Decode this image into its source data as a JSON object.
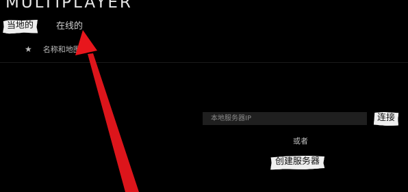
{
  "header": {
    "title": "MULTIPLAYER"
  },
  "tabs": {
    "local": "当地的",
    "online": "在线的"
  },
  "server_list": {
    "sort_label": "名称和地图",
    "sort_icon": "star-icon"
  },
  "connect_panel": {
    "ip_placeholder": "本地服务器IP",
    "connect_label": "连接",
    "or_label": "或者",
    "create_server_label": "创建服务器"
  },
  "annotation": {
    "arrow_color": "#e8161c",
    "arrow_icon": "red-arrow-icon"
  }
}
